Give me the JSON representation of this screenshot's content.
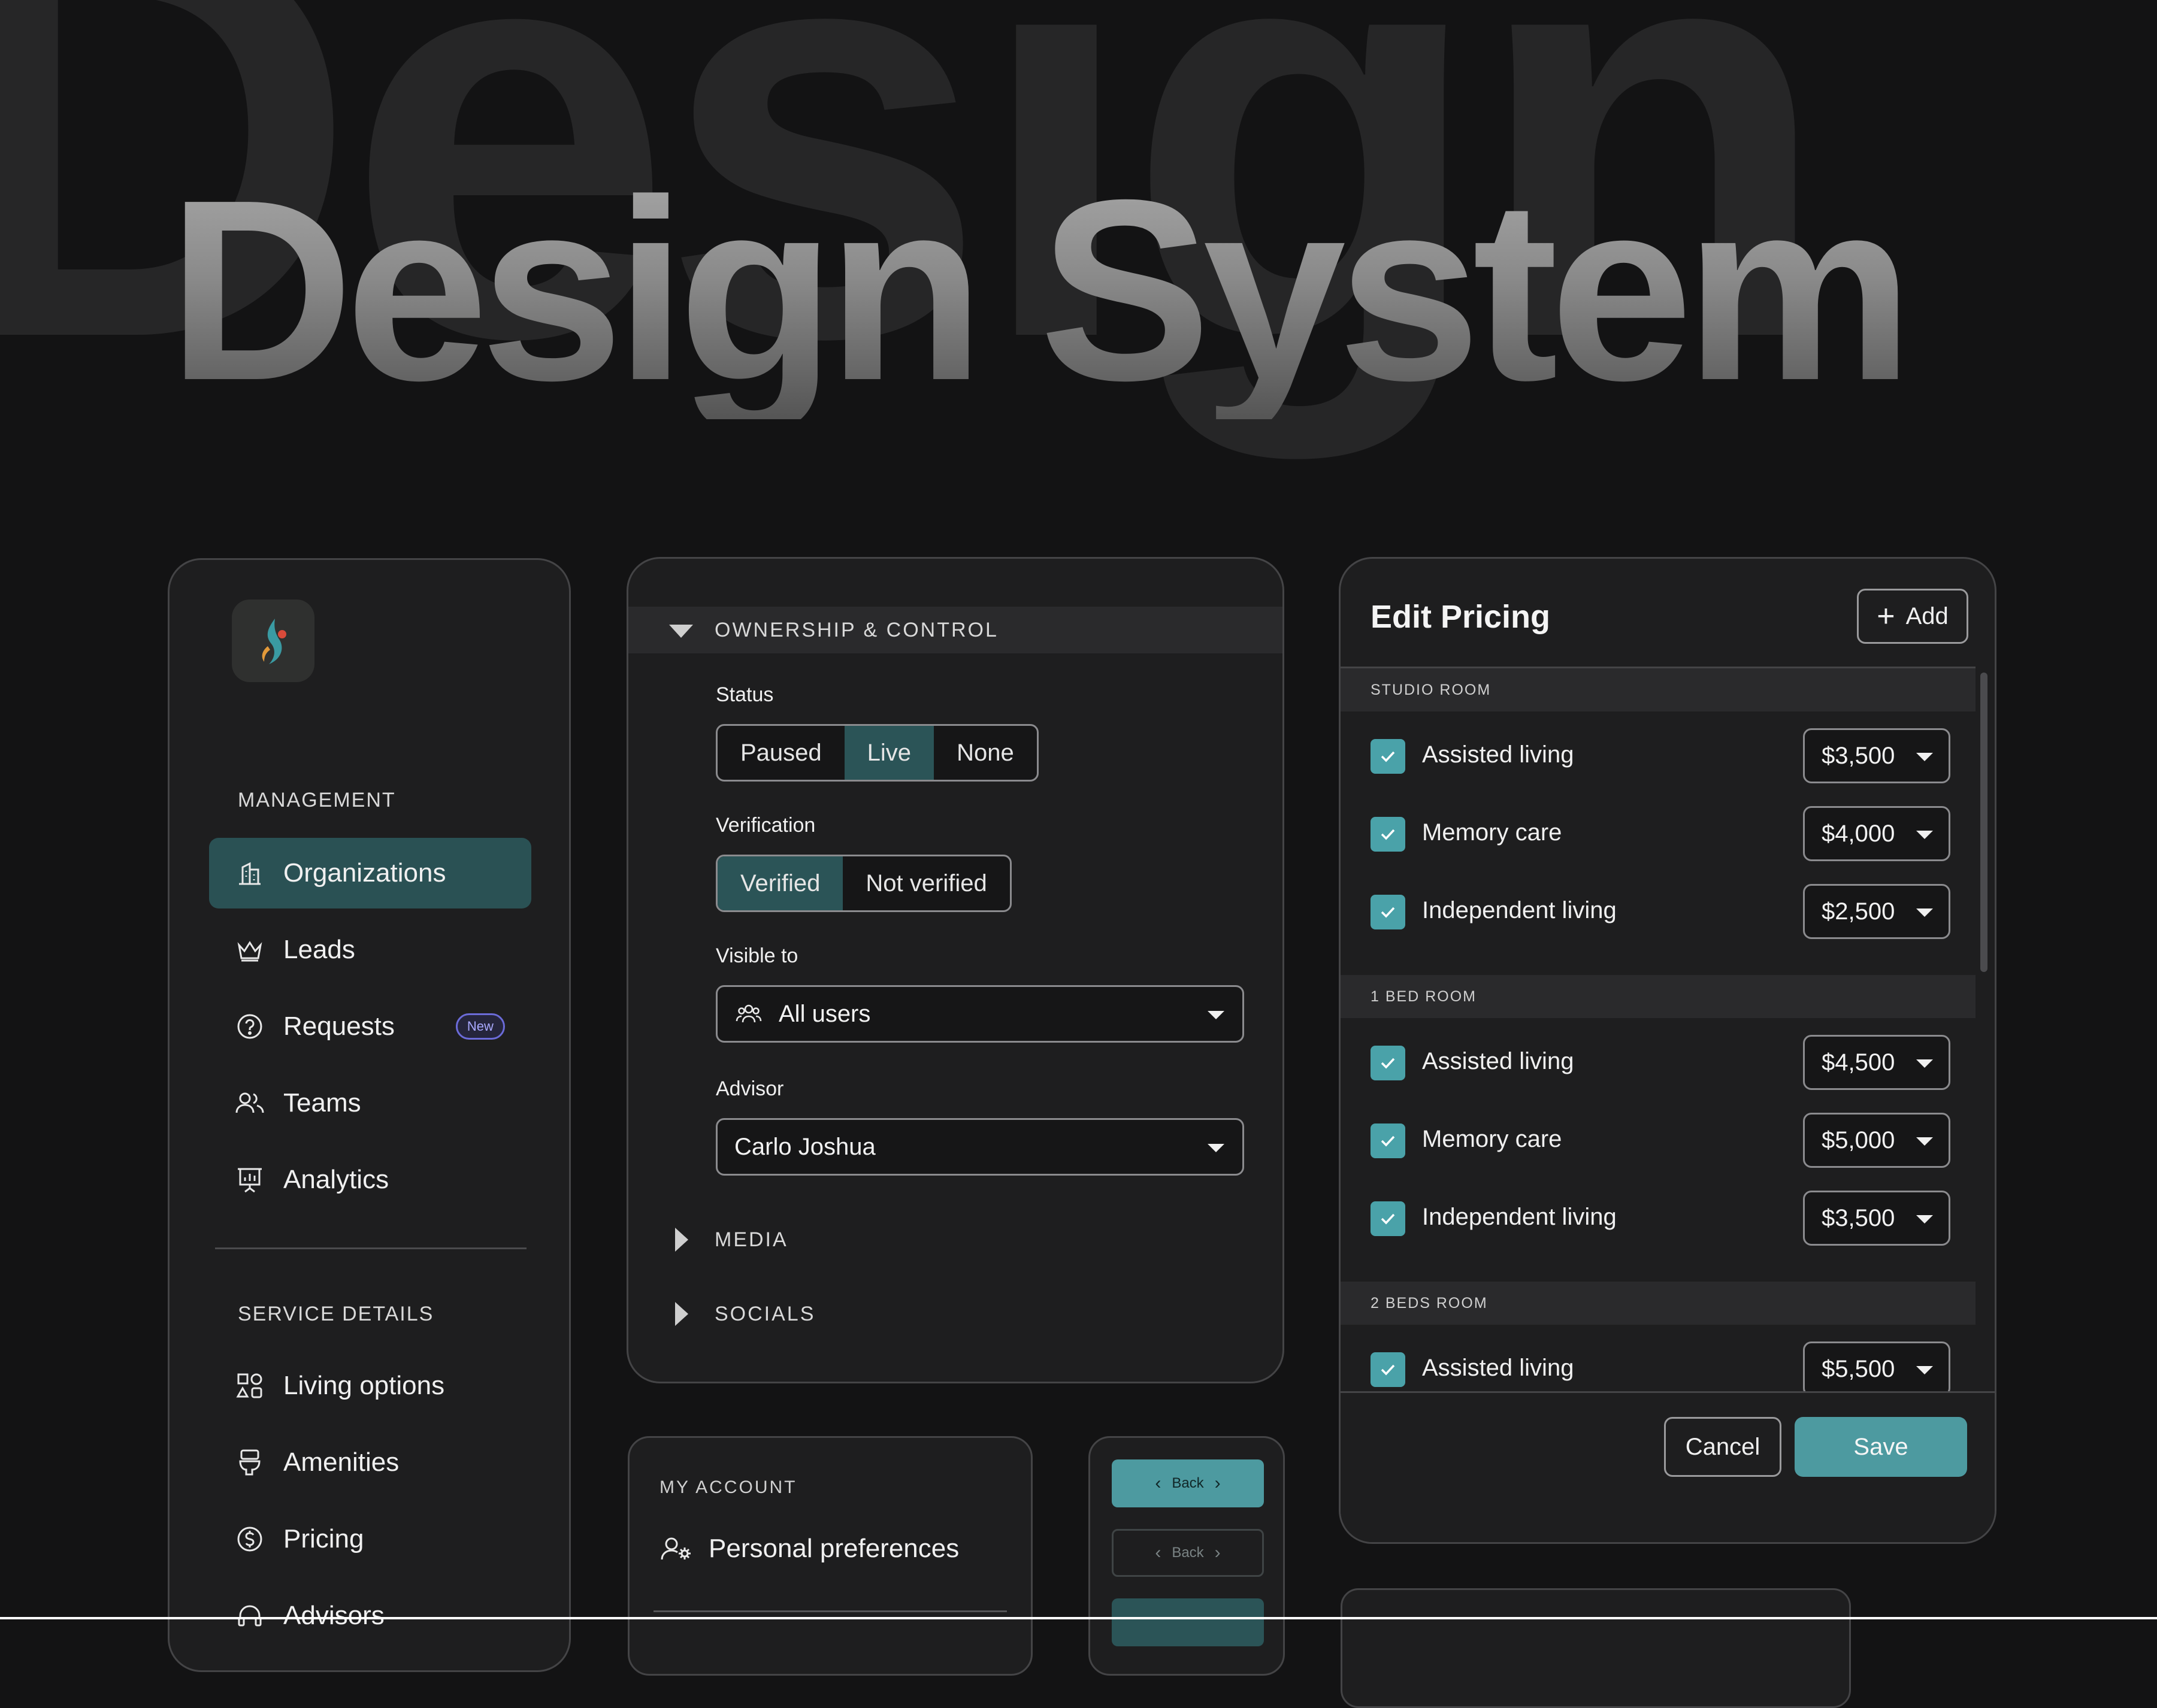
{
  "hero": {
    "background_word": "Design",
    "title": "Design System"
  },
  "sidebar": {
    "management_title": "MANAGEMENT",
    "items": [
      {
        "label": "Organizations",
        "icon": "building-icon",
        "active": true
      },
      {
        "label": "Leads",
        "icon": "crown-icon"
      },
      {
        "label": "Requests",
        "icon": "help-circle-icon",
        "badge": "New"
      },
      {
        "label": "Teams",
        "icon": "users-icon"
      },
      {
        "label": "Analytics",
        "icon": "presentation-chart-icon"
      }
    ],
    "service_title": "SERVICE DETAILS",
    "service_items": [
      {
        "label": "Living options",
        "icon": "shapes-icon"
      },
      {
        "label": "Amenities",
        "icon": "toilet-icon"
      },
      {
        "label": "Pricing",
        "icon": "dollar-circle-icon"
      },
      {
        "label": "Advisors",
        "icon": "headset-icon"
      }
    ]
  },
  "ownership": {
    "section_title": "OWNERSHIP & CONTROL",
    "status_label": "Status",
    "status_options": [
      "Paused",
      "Live",
      "None"
    ],
    "status_selected": "Live",
    "verification_label": "Verification",
    "verification_options": [
      "Verified",
      "Not verified"
    ],
    "verification_selected": "Verified",
    "visible_label": "Visible to",
    "visible_value": "All users",
    "advisor_label": "Advisor",
    "advisor_value": "Carlo Joshua",
    "media_title": "MEDIA",
    "socials_title": "SOCIALS"
  },
  "pricing": {
    "title": "Edit Pricing",
    "add_label": "Add",
    "groups": [
      {
        "name": "STUDIO ROOM",
        "rows": [
          {
            "label": "Assisted living",
            "price": "$3,500"
          },
          {
            "label": "Memory care",
            "price": "$4,000"
          },
          {
            "label": "Independent living",
            "price": "$2,500"
          }
        ]
      },
      {
        "name": "1 BED ROOM",
        "rows": [
          {
            "label": "Assisted living",
            "price": "$4,500"
          },
          {
            "label": "Memory care",
            "price": "$5,000"
          },
          {
            "label": "Independent living",
            "price": "$3,500"
          }
        ]
      },
      {
        "name": "2 BEDS ROOM",
        "rows": [
          {
            "label": "Assisted living",
            "price": "$5,500"
          }
        ]
      }
    ],
    "cancel_label": "Cancel",
    "save_label": "Save"
  },
  "account": {
    "section_title": "MY ACCOUNT",
    "item_label": "Personal preferences"
  },
  "buttons_demo": {
    "back_label": "Back"
  },
  "colors": {
    "accent": "#4d9aa0",
    "active_bg": "#2b5457",
    "background": "#131314",
    "panel": "#1e1e1f"
  }
}
